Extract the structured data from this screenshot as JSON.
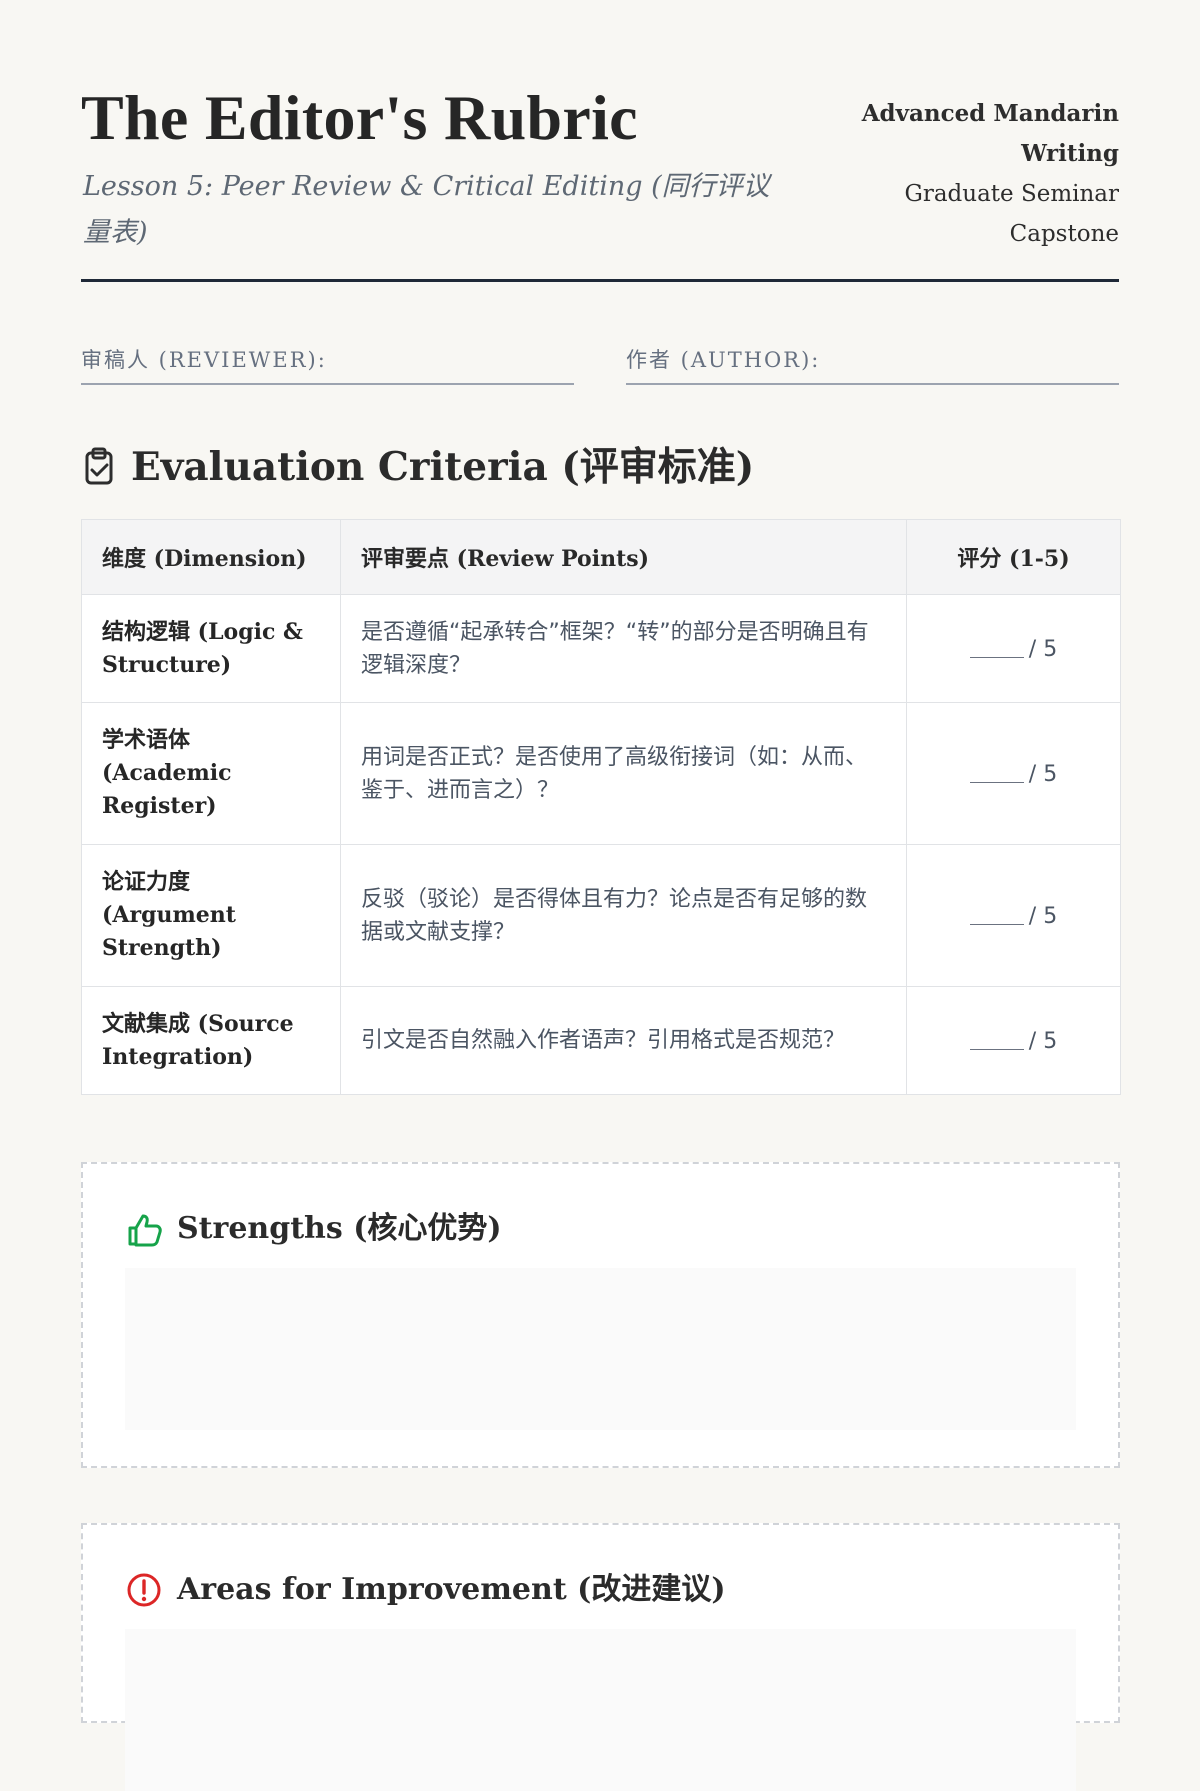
{
  "header": {
    "title": "The Editor's Rubric",
    "subtitle": "Lesson 5: Peer Review & Critical Editing (同行评议量表)",
    "course": "Advanced Mandarin Writing",
    "level": "Graduate Seminar",
    "unit": "Capstone"
  },
  "fields": {
    "reviewer_label": "审稿人 (REVIEWER):",
    "reviewer_value": "",
    "author_label": "作者 (AUTHOR):",
    "author_value": ""
  },
  "evaluation": {
    "heading": "Evaluation Criteria (评审标准)",
    "icon": "clipboard-check-icon",
    "columns": {
      "dimension": "维度 (Dimension)",
      "review_points": "评审要点 (Review Points)",
      "score": "评分 (1-5)"
    },
    "rows": [
      {
        "dimension": "结构逻辑 (Logic & Structure)",
        "review_point": "是否遵循“起承转合”框架？“转”的部分是否明确且有逻辑深度？",
        "score_suffix": "/ 5"
      },
      {
        "dimension": "学术语体 (Academic Register)",
        "review_point": "用词是否正式？是否使用了高级衔接词（如：从而、鉴于、进而言之）？",
        "score_suffix": "/ 5"
      },
      {
        "dimension": "论证力度 (Argument Strength)",
        "review_point": "反驳（驳论）是否得体且有力？论点是否有足够的数据或文献支撑？",
        "score_suffix": "/ 5"
      },
      {
        "dimension": "文献集成 (Source Integration)",
        "review_point": "引文是否自然融入作者语声？引用格式是否规范？",
        "score_suffix": "/ 5"
      }
    ]
  },
  "feedback": {
    "strengths": {
      "heading": "Strengths (核心优势)",
      "icon": "thumbs-up-icon",
      "value": ""
    },
    "improvement": {
      "heading": "Areas for Improvement (改进建议)",
      "icon": "alert-circle-icon",
      "value": ""
    }
  },
  "colors": {
    "background": "#f8f7f3",
    "primary_text": "#262626",
    "muted_text": "#5e6874",
    "rule": "#1f2937",
    "strengths_icon": "#16a34a",
    "improvement_icon": "#dc2626"
  }
}
